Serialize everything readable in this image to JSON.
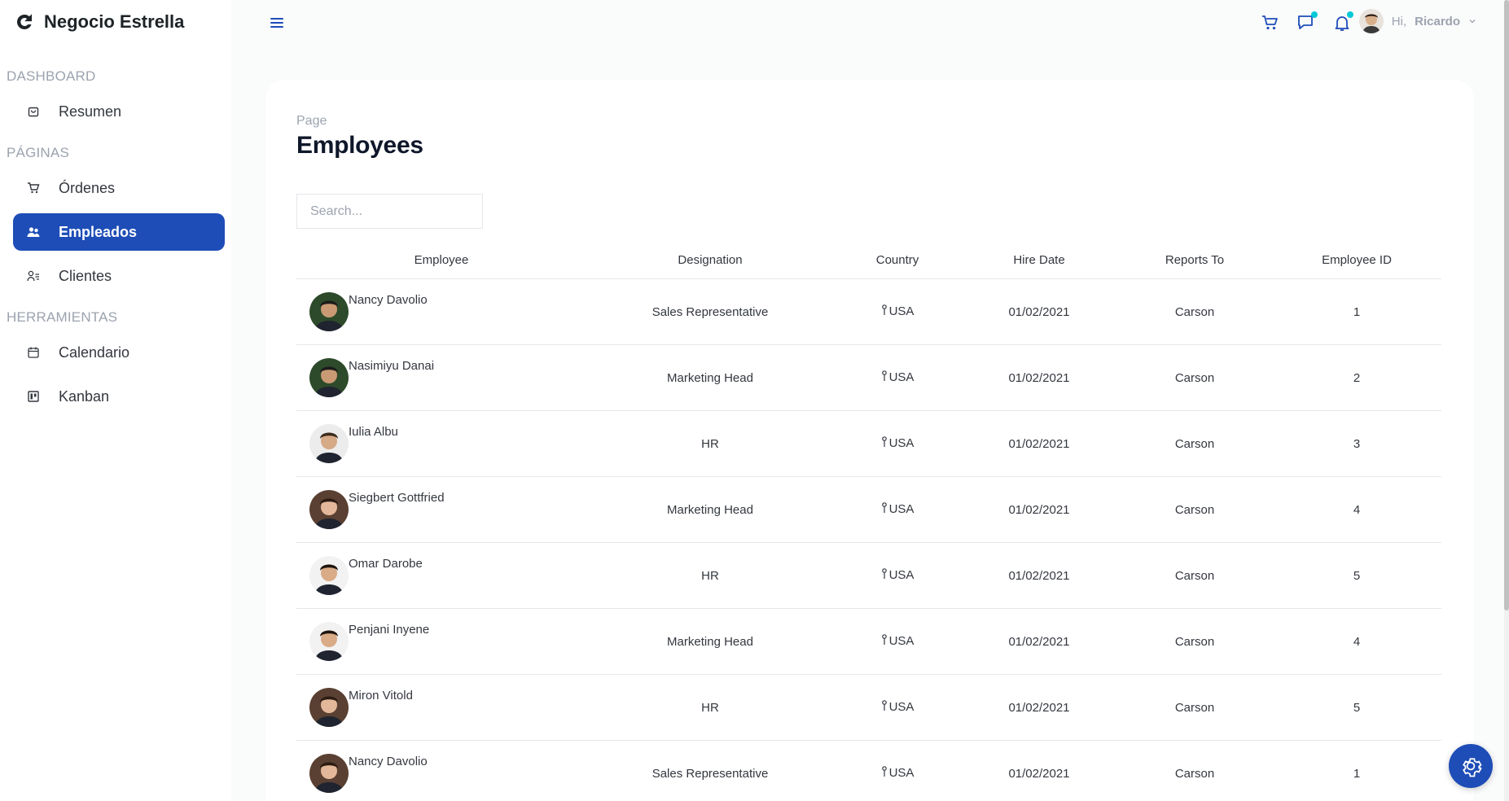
{
  "app": {
    "title": "Negocio Estrella"
  },
  "sidebar": {
    "sections": [
      {
        "title": "DASHBOARD",
        "items": [
          {
            "label": "Resumen",
            "icon": "shopping-bag-icon"
          }
        ]
      },
      {
        "title": "PÁGINAS",
        "items": [
          {
            "label": "Órdenes",
            "icon": "cart-icon"
          },
          {
            "label": "Empleados",
            "icon": "people-icon",
            "active": true
          },
          {
            "label": "Clientes",
            "icon": "user-list-icon"
          }
        ]
      },
      {
        "title": "HERRAMIENTAS",
        "items": [
          {
            "label": "Calendario",
            "icon": "calendar-icon"
          },
          {
            "label": "Kanban",
            "icon": "kanban-icon"
          }
        ]
      }
    ]
  },
  "header": {
    "greeting": "Hi,",
    "user_name": "Ricardo"
  },
  "page": {
    "kicker": "Page",
    "title": "Employees",
    "search_placeholder": "Search..."
  },
  "table": {
    "columns": [
      "Employee",
      "Designation",
      "Country",
      "Hire Date",
      "Reports To",
      "Employee ID"
    ],
    "rows": [
      {
        "name": "Nancy Davolio",
        "designation": "Sales Representative",
        "country": "USA",
        "hire_date": "01/02/2021",
        "reports_to": "Carson",
        "id": "1"
      },
      {
        "name": "Nasimiyu Danai",
        "designation": "Marketing Head",
        "country": "USA",
        "hire_date": "01/02/2021",
        "reports_to": "Carson",
        "id": "2"
      },
      {
        "name": "Iulia Albu",
        "designation": "HR",
        "country": "USA",
        "hire_date": "01/02/2021",
        "reports_to": "Carson",
        "id": "3"
      },
      {
        "name": "Siegbert Gottfried",
        "designation": "Marketing Head",
        "country": "USA",
        "hire_date": "01/02/2021",
        "reports_to": "Carson",
        "id": "4"
      },
      {
        "name": "Omar Darobe",
        "designation": "HR",
        "country": "USA",
        "hire_date": "01/02/2021",
        "reports_to": "Carson",
        "id": "5"
      },
      {
        "name": "Penjani Inyene",
        "designation": "Marketing Head",
        "country": "USA",
        "hire_date": "01/02/2021",
        "reports_to": "Carson",
        "id": "4"
      },
      {
        "name": "Miron Vitold",
        "designation": "HR",
        "country": "USA",
        "hire_date": "01/02/2021",
        "reports_to": "Carson",
        "id": "5"
      },
      {
        "name": "Nancy Davolio",
        "designation": "Sales Representative",
        "country": "USA",
        "hire_date": "01/02/2021",
        "reports_to": "Carson",
        "id": "1"
      }
    ]
  },
  "colors": {
    "accent": "#1e4db7",
    "notification_dot": "#03c9d7"
  }
}
